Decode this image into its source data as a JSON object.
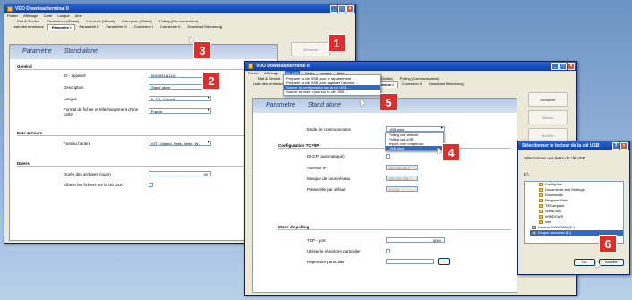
{
  "win1": {
    "title": "VDO Downloadterminal II",
    "menu": [
      "Fichier",
      "Affichage",
      "Carte",
      "Langue",
      "Aide"
    ],
    "tabs_row1": [
      "Etat & Service",
      "Paramètres (Global)",
      "Info texte (Global)",
      "Entreprise (Global)",
      "Polling (Communication)"
    ],
    "tabs_row2": [
      "Liste des terminaux",
      "Paramètre I",
      "Paramètre II",
      "Paramètre III",
      "Connexion I",
      "Connexion II",
      "Download Erinnerung"
    ],
    "header_left": "Paramètre",
    "header_right": "Stand alone",
    "general_label": "Général",
    "id_label": "ID - appareil",
    "id_value": "0010991111110",
    "desc_label": "Description",
    "desc_value": "Stand alone",
    "lang_label": "Langue",
    "lang_value": "fr_FR - French",
    "date_format_label": "Format de fichier et téléchargement d'une carte",
    "date_format_value": "France",
    "datetime_label": "Date & Heure",
    "timezone_label": "Fuseau horaire",
    "timezone_value": "(GT - Madrid, Paris, Berlin, W...",
    "misc_label": "Divers",
    "duration_label": "Durée des archives (jours)",
    "duration_value": "90",
    "erase_label": "Effacer les fichiers sur la clé DLK",
    "side_button": "Démarrer"
  },
  "win2": {
    "title": "VDO Downloadterminal II",
    "menu": [
      "Fichier",
      "Affichage",
      "Clé USB",
      "Outils",
      "Langue",
      "Aide"
    ],
    "usb_menu": [
      "Préparer la clé USB pour le rapatriement ...",
      "Préparer la clé USB pour capturer l'archive ...",
      "Sauver la configuration sur la clé USB ...",
      "Sauver la mise à jour sur la clé USB ..."
    ],
    "tabs_row1": [
      "Etat & Service",
      "Paramètres (Global)",
      "Info texte (Global)",
      "Entreprise (Global)",
      "Polling (Communication)"
    ],
    "tabs_row2": [
      "Liste des terminaux",
      "Paramètre I",
      "Paramètre II",
      "Paramètre III",
      "Connexion I",
      "Connexion II",
      "Download Erinnerung"
    ],
    "header_left": "Paramètre",
    "header_right": "Stand alone",
    "comm_mode_label": "Mode de communication",
    "comm_mode_value": "USB-stick",
    "comm_options": [
      "Polling via network",
      "Polling via USB",
      "Import over ontgeboor",
      "USB-stick"
    ],
    "tcpip_label": "Configuration TCP/IP",
    "dhcp_label": "DHCP (automatique)",
    "ip_label": "Adresse IP",
    "ip_value": "192.168.98.1",
    "mask_label": "Masque de sous-réseau",
    "mask_value": "255.255.255.0",
    "gateway_label": "Passerelle par défaut",
    "gateway_value": "0.0.0.0",
    "polling_label": "Mode de polling",
    "tcp_port_label": "TCP - port",
    "tcp_port_value": "8000",
    "use_dir_label": "Utiliser le répertoire particulier",
    "dir_label": "Répertoire particulier",
    "browse_label": "...",
    "side_buttons": [
      "Démarrer",
      "Effacer",
      "Modifier"
    ]
  },
  "dialog": {
    "title": "Sélectionner le lecteur de la clé USB",
    "prompt": "Sélectionner une lettre de clé USB",
    "drive_value": "E:\\",
    "tree": [
      "Config.Msi",
      "Documents and Settings",
      "Downloads",
      "Program Files",
      "TECompact",
      "WEBCMS",
      "WINDOWS",
      "xml",
      "Lecteur DVD-RAM (E:)",
      "Disque amovible (E:)"
    ],
    "ok": "OK",
    "cancel": "Annuler"
  },
  "callouts": [
    "1",
    "2",
    "3",
    "4",
    "5",
    "6"
  ],
  "colors": {
    "callout": "#e22b2b",
    "titlebar": "#0b3ea8",
    "highlight": "#316ac5"
  }
}
